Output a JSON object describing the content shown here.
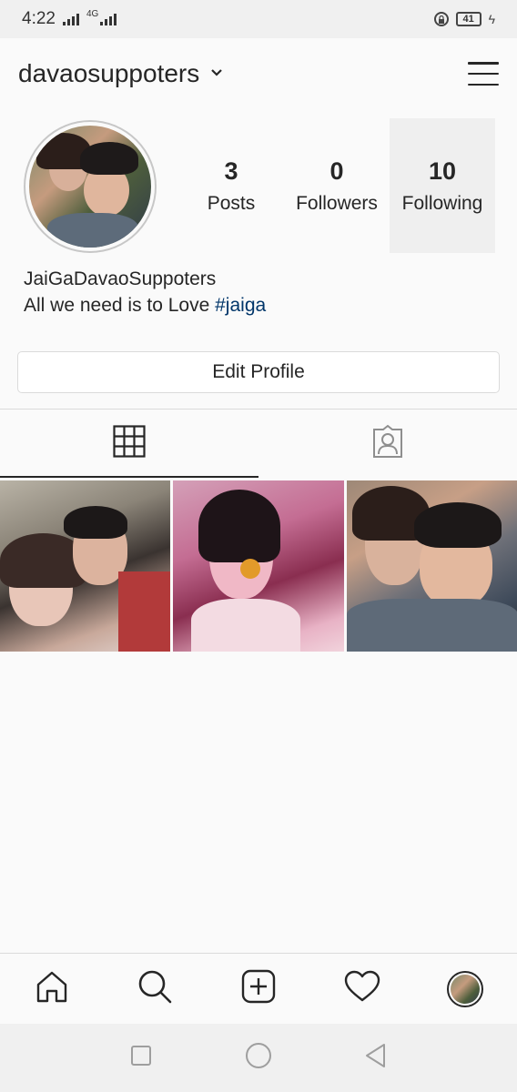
{
  "status_bar": {
    "time": "4:22",
    "network": "4G",
    "battery": "41"
  },
  "header": {
    "username": "davaosuppoters"
  },
  "profile": {
    "stats": [
      {
        "value": "3",
        "label": "Posts"
      },
      {
        "value": "0",
        "label": "Followers"
      },
      {
        "value": "10",
        "label": "Following"
      }
    ],
    "name": "JaiGaDavaoSuppoters",
    "bio_text": "All we need is to Love ",
    "bio_hashtag": "#jaiga"
  },
  "edit_profile_label": "Edit Profile",
  "tabs": [
    {
      "icon": "grid-icon",
      "active": true
    },
    {
      "icon": "tagged-person-icon",
      "active": false
    }
  ],
  "posts": [
    {
      "icon": "photo"
    },
    {
      "icon": "photo"
    },
    {
      "icon": "photo"
    }
  ],
  "bottom_nav": [
    {
      "icon": "home-icon"
    },
    {
      "icon": "search-icon"
    },
    {
      "icon": "add-post-icon"
    },
    {
      "icon": "heart-icon"
    },
    {
      "icon": "profile-avatar-icon"
    }
  ],
  "colors": {
    "background": "#fafafa",
    "text": "#262626",
    "hashtag": "#003569",
    "border": "#dbdbdb"
  }
}
